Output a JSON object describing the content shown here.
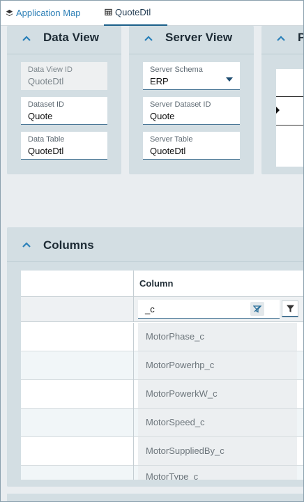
{
  "tabs": [
    {
      "label": "Application Map",
      "icon": "layers-icon"
    },
    {
      "label": "QuoteDtl",
      "icon": "table-icon"
    }
  ],
  "data_view": {
    "title": "Data View",
    "fields": [
      {
        "label": "Data View ID",
        "value": "QuoteDtl"
      },
      {
        "label": "Dataset ID",
        "value": "Quote"
      },
      {
        "label": "Data Table",
        "value": "QuoteDtl"
      }
    ]
  },
  "server_view": {
    "title": "Server View",
    "fields": [
      {
        "label": "Server Schema",
        "value": "ERP"
      },
      {
        "label": "Server Dataset ID",
        "value": "Quote"
      },
      {
        "label": "Server Table",
        "value": "QuoteDtl"
      }
    ]
  },
  "third_panel": {
    "title": "P"
  },
  "columns": {
    "title": "Columns",
    "header": "Column",
    "filter_value": "_c",
    "rows": [
      "MotorPhase_c",
      "MotorPowerhp_c",
      "MotorPowerkW_c",
      "MotorSpeed_c",
      "MotorSuppliedBy_c",
      "MotorType_c"
    ]
  },
  "colors": {
    "accent": "#2a80b9",
    "panel_bg": "#d3dee3",
    "page_bg": "#e9edf0"
  }
}
